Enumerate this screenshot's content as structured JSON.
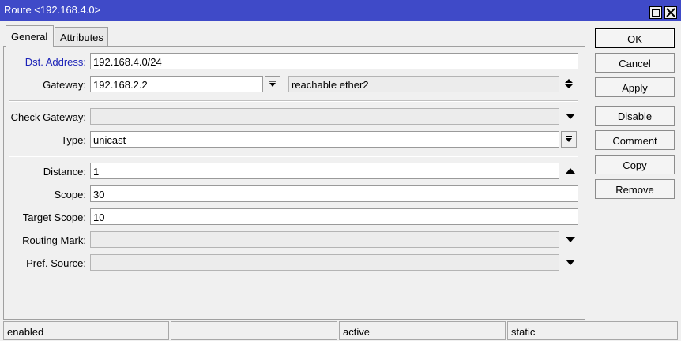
{
  "window": {
    "title": "Route <192.168.4.0>"
  },
  "tabs": [
    {
      "label": "General"
    },
    {
      "label": "Attributes"
    }
  ],
  "form": {
    "dst_address": {
      "label": "Dst. Address:",
      "value": "192.168.4.0/24"
    },
    "gateway": {
      "label": "Gateway:",
      "value": "192.168.2.2",
      "status": "reachable ether2"
    },
    "check_gateway": {
      "label": "Check Gateway:",
      "value": ""
    },
    "type": {
      "label": "Type:",
      "value": "unicast"
    },
    "distance": {
      "label": "Distance:",
      "value": "1"
    },
    "scope": {
      "label": "Scope:",
      "value": "30"
    },
    "target_scope": {
      "label": "Target Scope:",
      "value": "10"
    },
    "routing_mark": {
      "label": "Routing Mark:",
      "value": ""
    },
    "pref_source": {
      "label": "Pref. Source:",
      "value": ""
    }
  },
  "buttons": {
    "ok": "OK",
    "cancel": "Cancel",
    "apply": "Apply",
    "disable": "Disable",
    "comment": "Comment",
    "copy": "Copy",
    "remove": "Remove"
  },
  "status": {
    "enabled": "enabled",
    "empty": "",
    "active": "active",
    "static": "static"
  },
  "icons": {
    "maximize": "maximize-icon",
    "close": "close-icon",
    "dropdown": "triangle-down-icon",
    "spin": "up-down-arrows-icon",
    "collapse": "triangle-up-icon",
    "select": "select-down-icon"
  },
  "colors": {
    "titlebar": "#3f4ac8",
    "label_highlight": "#1b22b8"
  }
}
